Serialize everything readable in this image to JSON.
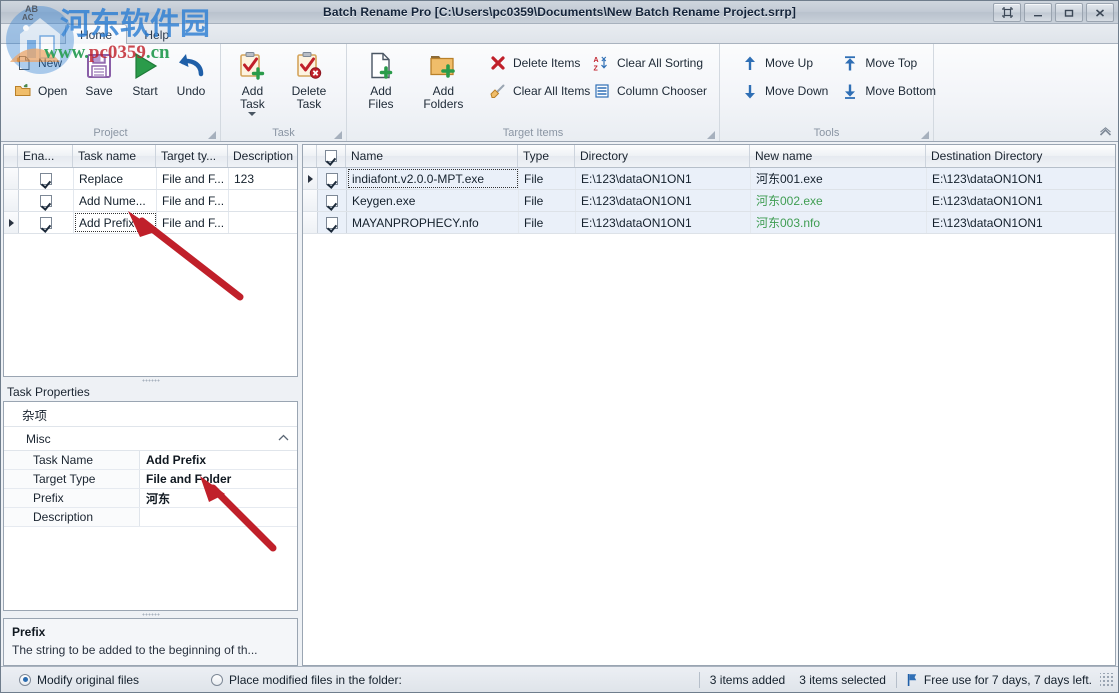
{
  "window": {
    "title": "Batch Rename Pro [C:\\Users\\pc0359\\Documents\\New Batch Rename Project.srrp]",
    "controls": {
      "restore_small": "restore-down-icon",
      "minimize": "minimize-icon",
      "maximize": "maximize-icon",
      "close": "close-icon"
    }
  },
  "tabs": [
    {
      "label": "Home",
      "active": true
    },
    {
      "label": "Help",
      "active": false
    }
  ],
  "ribbon": {
    "collapse_icon": "chevron-up-icon",
    "groups": [
      {
        "name": "Project",
        "label": "Project",
        "small_buttons": [
          {
            "label": "New",
            "icon": "new-document-icon"
          },
          {
            "label": "Open",
            "icon": "open-folder-icon"
          }
        ],
        "big_buttons": [
          {
            "label": "Save",
            "icon": "floppy-disk-icon"
          },
          {
            "label": "Start",
            "icon": "play-triangle-icon"
          },
          {
            "label": "Undo",
            "icon": "undo-arrow-icon"
          }
        ]
      },
      {
        "name": "Task",
        "label": "Task",
        "big_buttons": [
          {
            "label": "Add Task",
            "icon": "clipboard-add-icon",
            "has_dropdown": true
          },
          {
            "label": "Delete Task",
            "icon": "clipboard-delete-icon",
            "has_dropdown": false
          }
        ]
      },
      {
        "name": "TargetItems",
        "label": "Target Items",
        "big_buttons": [
          {
            "label": "Add Files",
            "icon": "file-add-icon"
          },
          {
            "label": "Add Folders",
            "icon": "folder-add-icon"
          }
        ],
        "small_col_1": [
          {
            "label": "Delete Items",
            "icon": "red-x-icon"
          },
          {
            "label": "Clear All Items",
            "icon": "brush-icon"
          }
        ],
        "small_col_2": [
          {
            "label": "Clear All Sorting",
            "icon": "az-sort-clear-icon"
          },
          {
            "label": "Column Chooser",
            "icon": "columns-icon"
          }
        ]
      },
      {
        "name": "Tools",
        "label": "Tools",
        "small_col_1": [
          {
            "label": "Move Up",
            "icon": "arrow-up-icon"
          },
          {
            "label": "Move Down",
            "icon": "arrow-down-icon"
          }
        ],
        "small_col_2": [
          {
            "label": "Move Top",
            "icon": "arrow-top-icon"
          },
          {
            "label": "Move Bottom",
            "icon": "arrow-bottom-icon"
          }
        ]
      }
    ]
  },
  "task_grid": {
    "columns": [
      "Ena...",
      "Task name",
      "Target ty...",
      "Description"
    ],
    "rows": [
      {
        "enabled": true,
        "task_name": "Replace",
        "target_type": "File and F...",
        "description": "123",
        "current": false
      },
      {
        "enabled": true,
        "task_name": "Add Nume...",
        "target_type": "File and F...",
        "description": "",
        "current": false
      },
      {
        "enabled": true,
        "task_name": "Add Prefix",
        "target_type": "File and F...",
        "description": "",
        "current": true
      }
    ]
  },
  "task_properties": {
    "caption": "Task Properties",
    "category": "杂项",
    "group": "Misc",
    "rows": [
      {
        "key": "Task Name",
        "value": "Add Prefix"
      },
      {
        "key": "Target Type",
        "value": "File and Folder"
      },
      {
        "key": "Prefix",
        "value": "河东"
      },
      {
        "key": "Description",
        "value": ""
      }
    ]
  },
  "description_box": {
    "title": "Prefix",
    "text": "The string to be added to the beginning of th..."
  },
  "file_grid": {
    "columns": [
      "Name",
      "Type",
      "Directory",
      "New name",
      "Destination Directory"
    ],
    "header_checkbox": true,
    "rows": [
      {
        "checked": true,
        "name": "indiafont.v2.0.0-MPT.exe",
        "type": "File",
        "directory": "E:\\123\\dataON1ON1",
        "new_name": "河东001.exe",
        "new_name_color": "#14202c",
        "destination": "E:\\123\\dataON1ON1",
        "current": true
      },
      {
        "checked": true,
        "name": "Keygen.exe",
        "type": "File",
        "directory": "E:\\123\\dataON1ON1",
        "new_name": "河东002.exe",
        "new_name_color": "#3f9d52",
        "destination": "E:\\123\\dataON1ON1",
        "current": false
      },
      {
        "checked": true,
        "name": "MAYANPROPHECY.nfo",
        "type": "File",
        "directory": "E:\\123\\dataON1ON1",
        "new_name": "河东003.nfo",
        "new_name_color": "#3f9d52",
        "destination": "E:\\123\\dataON1ON1",
        "current": false
      }
    ]
  },
  "status_bar": {
    "radio_modify": "Modify original files",
    "radio_place": "Place modified files in the folder:",
    "selected_radio": "modify",
    "items_added": "3 items added",
    "items_selected": "3 items selected",
    "license": "Free use for 7 days, 7 days left.",
    "flag_icon": "blue-flag-icon"
  },
  "watermark": {
    "chinese": "河东软件园",
    "url": "www.pc0359.cn"
  },
  "colors": {
    "accent_blue": "#2d7fd4",
    "green_text": "#3f9d52",
    "red_marker": "#c0202a",
    "selection": "#eaf0f9"
  }
}
